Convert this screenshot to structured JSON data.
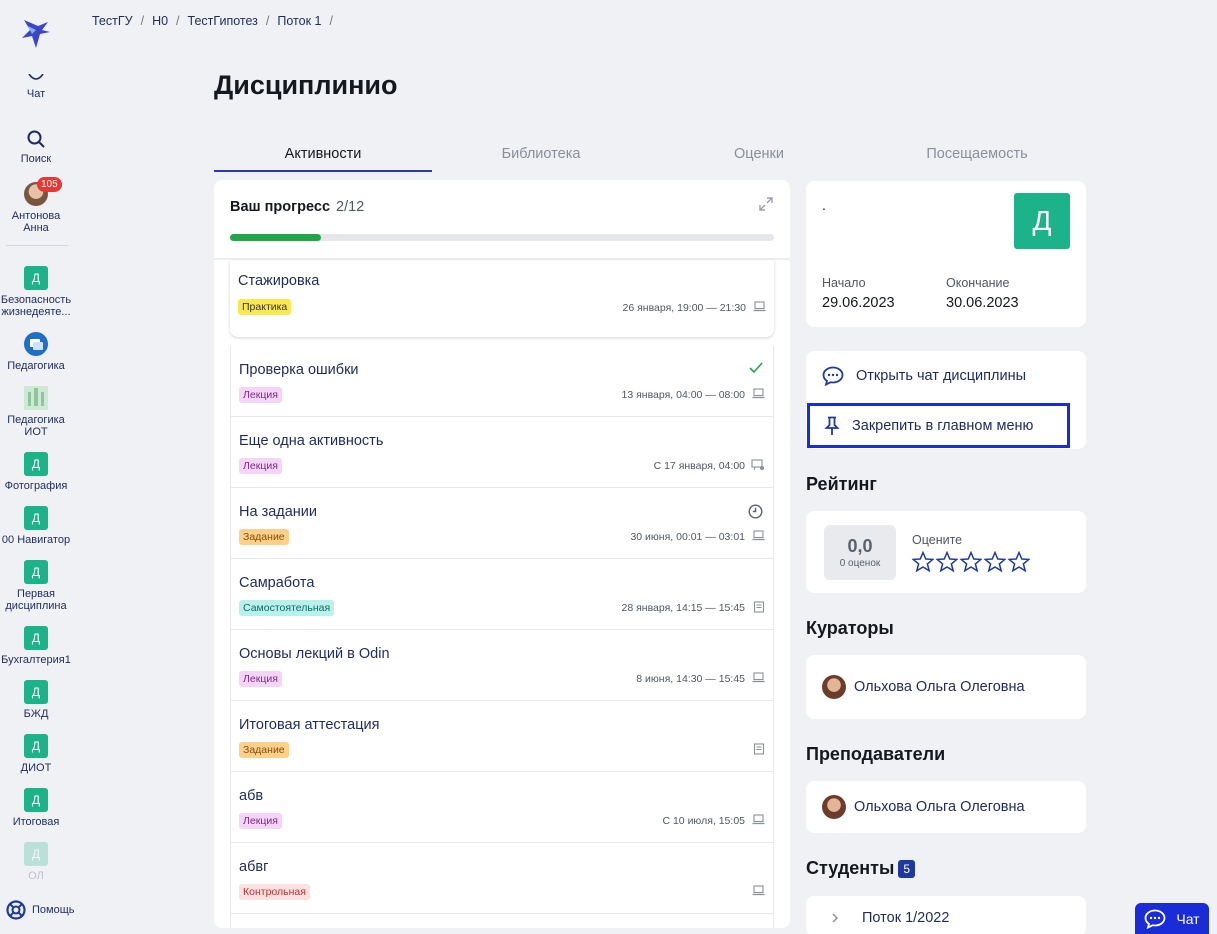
{
  "sidebar": {
    "chat": "Чат",
    "search": "Поиск",
    "user": {
      "line1": "Антонова",
      "line2": "Анна",
      "badge": "105"
    },
    "courses": [
      {
        "icon": "Д",
        "line1": "Безопасность",
        "line2": "жизнедеяте..."
      },
      {
        "line1": "Педагогика"
      },
      {
        "line1": "Педагогика",
        "line2": "ИОТ"
      },
      {
        "icon": "Д",
        "line1": "Фотография"
      },
      {
        "icon": "Д",
        "line1": "00 Навигатор"
      },
      {
        "icon": "Д",
        "line1": "Первая",
        "line2": "дисциплина"
      },
      {
        "icon": "Д",
        "line1": "Бухгалтерия1"
      },
      {
        "icon": "Д",
        "line1": "БЖД"
      },
      {
        "icon": "Д",
        "line1": "ДИОТ"
      },
      {
        "icon": "Д",
        "line1": "Итоговая"
      },
      {
        "icon": "Д",
        "line1": "ОЛ"
      }
    ],
    "help": "Помощь"
  },
  "breadcrumb": [
    "ТестГУ",
    "Н0",
    "ТестГипотез",
    "Поток 1"
  ],
  "breadcrumb_sep": "/",
  "title": "Дисциплинио",
  "tabs": [
    "Активности",
    "Библиотека",
    "Оценки",
    "Посещаемость"
  ],
  "progress": {
    "label": "Ваш прогресс",
    "count": "2/12",
    "fraction": 0.1667
  },
  "activities": [
    {
      "title": "Стажировка",
      "tag": "Практика",
      "date": "26 января, 19:00 — 21:30",
      "type": "laptop"
    },
    {
      "title": "Проверка ошибки",
      "tag": "Лекция",
      "date": "13 января, 04:00 — 08:00",
      "type": "laptop",
      "status": "check"
    },
    {
      "title": "Еще одна активность",
      "tag": "Лекция",
      "date": "С 17 января, 04:00",
      "type": "presentation"
    },
    {
      "title": "На задании",
      "tag": "Задание",
      "date": "30 июня, 00:01 — 03:01",
      "type": "laptop",
      "status": "clock"
    },
    {
      "title": "Самработа",
      "tag": "Самостоятельная",
      "date": "28 января, 14:15 — 15:45",
      "type": "book"
    },
    {
      "title": "Основы лекций в Odin",
      "tag": "Лекция",
      "date": "8 июня, 14:30 — 15:45",
      "type": "laptop"
    },
    {
      "title": "Итоговая аттестация",
      "tag": "Задание",
      "date": "",
      "type": "book"
    },
    {
      "title": "абв",
      "tag": "Лекция",
      "date": "С 10 июля, 15:05",
      "type": "laptop"
    },
    {
      "title": "абвг",
      "tag": "Контрольная",
      "date": "",
      "type": "laptop"
    }
  ],
  "info": {
    "dot": ".",
    "letter": "Д",
    "start_label": "Начало",
    "start": "29.06.2023",
    "end_label": "Окончание",
    "end": "30.06.2023"
  },
  "actions": {
    "open_chat": "Открыть чат дисциплины",
    "pin": "Закрепить в главном меню"
  },
  "rating": {
    "title": "Рейтинг",
    "score": "0,0",
    "count": "0 оценок",
    "rate_label": "Оцените"
  },
  "curators": {
    "title": "Кураторы",
    "name": "Ольхова Ольга Олеговна"
  },
  "teachers": {
    "title": "Преподаватели",
    "name": "Ольхова Ольга Олеговна"
  },
  "students": {
    "title": "Студенты",
    "count": "5",
    "stream": "Поток 1/2022"
  },
  "chat_fab": "Чат",
  "colors": {
    "accent": "#1a2bd8",
    "course_icon": "#1cb38b",
    "progress": "#22a54a"
  }
}
